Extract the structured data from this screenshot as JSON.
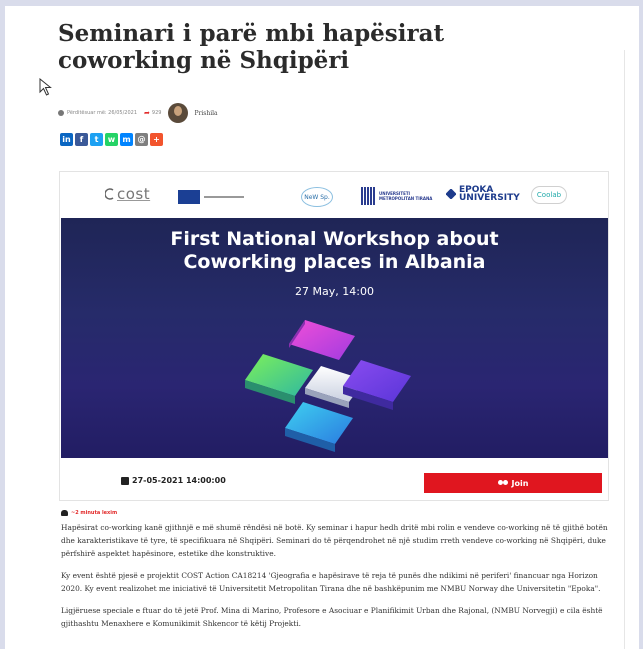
{
  "article": {
    "title": "Seminari i parë mbi hapësirat coworking në Shqipëri",
    "meta": {
      "published": "Përditësuar më: 26/05/2021",
      "shares": "929",
      "author": "Prishila"
    },
    "socials": [
      {
        "name": "linkedin",
        "glyph": "in",
        "color": "#0a66c2"
      },
      {
        "name": "facebook",
        "glyph": "f",
        "color": "#3b5998"
      },
      {
        "name": "twitter",
        "glyph": "t",
        "color": "#1da1f2"
      },
      {
        "name": "whatsapp",
        "glyph": "w",
        "color": "#25d366"
      },
      {
        "name": "messenger",
        "glyph": "m",
        "color": "#0084ff"
      },
      {
        "name": "email",
        "glyph": "@",
        "color": "#7f7f7f"
      },
      {
        "name": "more",
        "glyph": "+",
        "color": "#f2542d"
      }
    ],
    "banner": {
      "logos": [
        "cost",
        "NeW Sp.",
        "UNIVERSITETI METROPOLITAN TIRANA",
        "EPOKA UNIVERSITY",
        "Coolab"
      ],
      "headline_1": "First National Workshop about",
      "headline_2": "Coworking places in Albania",
      "date": "27 May, 14:00"
    },
    "event": {
      "datetime": "27-05-2021 14:00:00",
      "join_label": "Join"
    },
    "read_time": "~2 minuta lexim",
    "paragraphs": [
      "Hapësirat co-working kanë gjithnjë e më shumë rëndësi në botë. Ky seminar i hapur hedh dritë mbi rolin e vendeve co-working në të gjithë botën dhe karakteristikave të tyre, të specifikuara në Shqipëri. Seminari do të përqendrohet në një studim rreth vendeve co-working në Shqipëri, duke përfshirë aspektet hapësinore, estetike dhe konstruktive.",
      "Ky event është pjesë e projektit COST Action CA18214 'Gjeografia e hapësirave të reja të punës dhe ndikimi në periferi' financuar nga Horizon 2020. Ky event realizohet me iniciativë të Universitetit Metropolitan Tirana dhe në bashkëpunim me NMBU Norway dhe Universitetin \"Epoka\".",
      "Ligjëruese speciale e ftuar do të jetë Prof. Mina di Marino, Profesore e Asociuar e Planifikimit Urban dhe Rajonal, (NMBU Norvegji) e cila është gjithashtu Menaxhere e Komunikimit Shkencor të këtij Projekti."
    ]
  }
}
